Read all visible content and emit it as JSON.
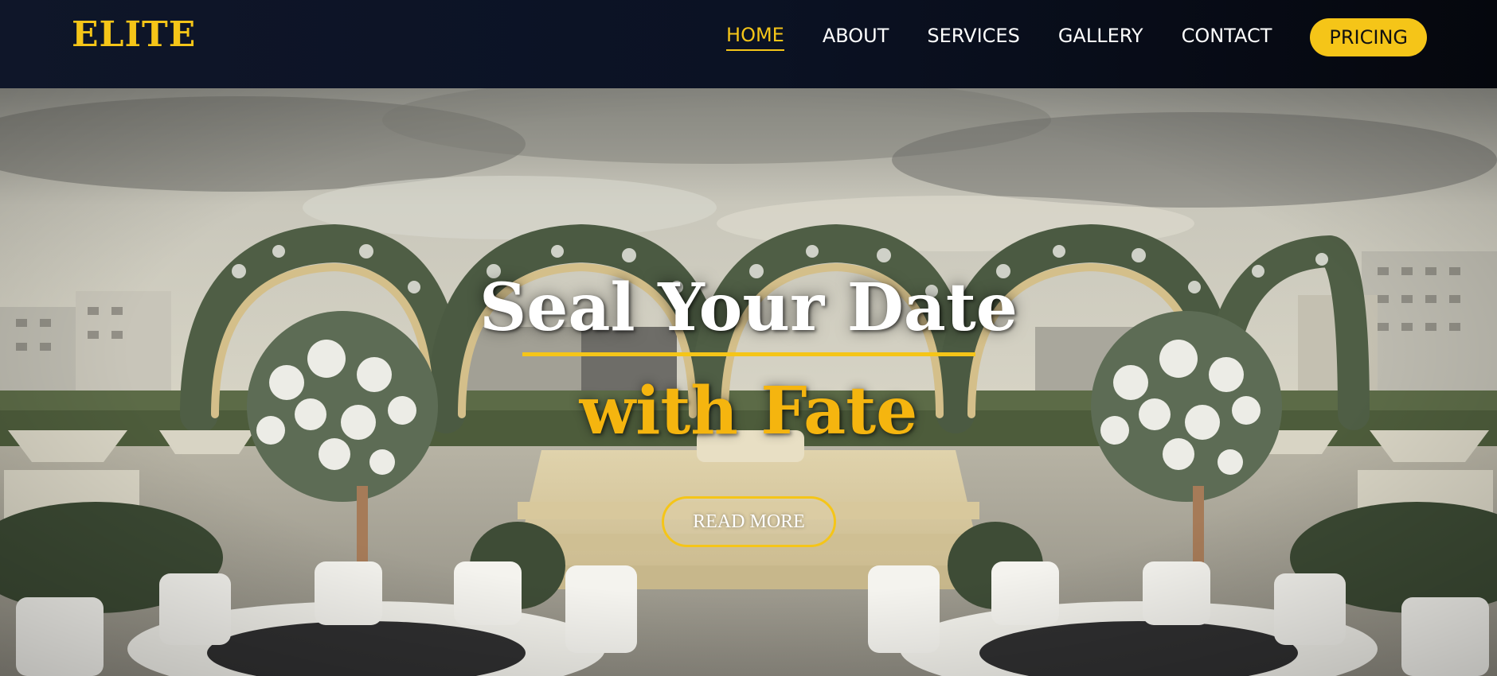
{
  "brand": {
    "logo_text": "ELITE",
    "accent_color": "#f5c518"
  },
  "nav": {
    "items": [
      {
        "label": "HOME",
        "active": true
      },
      {
        "label": "ABOUT",
        "active": false
      },
      {
        "label": "SERVICES",
        "active": false
      },
      {
        "label": "GALLERY",
        "active": false
      },
      {
        "label": "CONTACT",
        "active": false
      }
    ],
    "cta_label": "PRICING"
  },
  "hero": {
    "title_line1": "Seal Your Date",
    "title_line2": "with Fate",
    "button_label": "READ MORE",
    "background": "wedding-venue-photo"
  }
}
